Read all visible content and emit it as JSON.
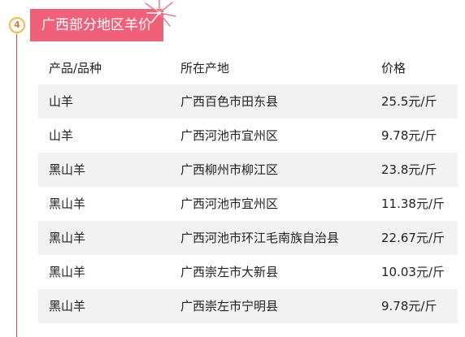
{
  "section": {
    "number": "4",
    "title": "广西部分地区羊价"
  },
  "table": {
    "headers": [
      "产品/品种",
      "所在产地",
      "价格"
    ],
    "rows": [
      [
        "山羊",
        "广西百色市田东县",
        "25.5元/斤"
      ],
      [
        "山羊",
        "广西河池市宜州区",
        "9.78元/斤"
      ],
      [
        "黑山羊",
        "广西柳州市柳江区",
        "23.8元/斤"
      ],
      [
        "黑山羊",
        "广西河池市宜州区",
        "11.38元/斤"
      ],
      [
        "黑山羊",
        "广西河池市环江毛南族自治县",
        "22.67元/斤"
      ],
      [
        "黑山羊",
        "广西崇左市大新县",
        "10.03元/斤"
      ],
      [
        "黑山羊",
        "广西崇左市宁明县",
        "9.78元/斤"
      ]
    ]
  },
  "colors": {
    "accent_pink": "#f06079",
    "badge_ring": "#f2b94e",
    "timeline_red": "#d9453c",
    "row_shade": "#f2f2f2"
  },
  "icons": {
    "decoration": "firework-burst-icon"
  }
}
